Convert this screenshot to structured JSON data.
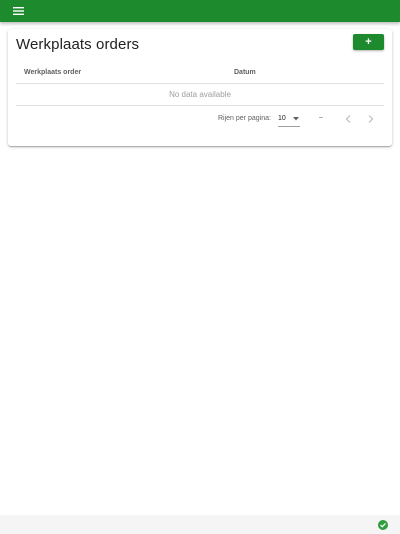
{
  "colors": {
    "brand_green": "#1e8a2e",
    "status_ok": "#2e9e3e",
    "divider": "#e0e0e0"
  },
  "app_bar": {
    "menu_icon": "menu-icon"
  },
  "card": {
    "title": "Werkplaats orders",
    "add_button_label": "+"
  },
  "table": {
    "columns": [
      "Werkplaats order",
      "Datum"
    ],
    "empty_text": "No data available"
  },
  "pagination": {
    "rows_per_page_label": "Rijen per pagina:",
    "rows_per_page_value": "10",
    "range_text": "–",
    "prev_icon": "chevron-left-icon",
    "next_icon": "chevron-right-icon"
  },
  "footer": {
    "status_icon": "check-circle-icon"
  }
}
